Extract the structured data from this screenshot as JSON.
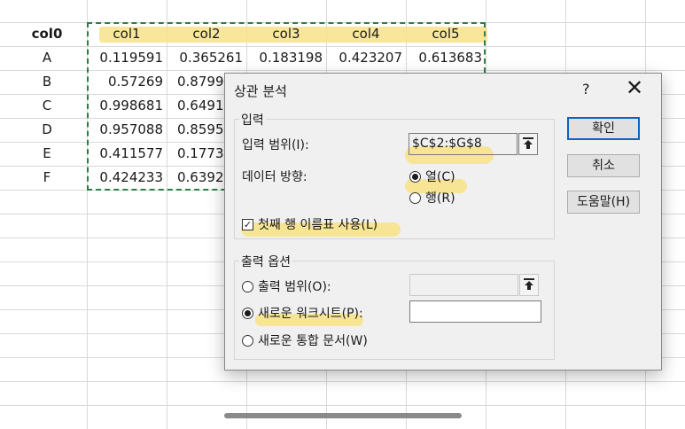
{
  "sheet": {
    "header": [
      "col0",
      "col1",
      "col2",
      "col3",
      "col4",
      "col5"
    ],
    "rows": [
      [
        "A",
        "0.119591",
        "0.365261",
        "0.183198",
        "0.423207",
        "0.613683"
      ],
      [
        "B",
        "0.57269",
        "0.8799"
      ],
      [
        "C",
        "0.998681",
        "0.6491"
      ],
      [
        "D",
        "0.957088",
        "0.8595"
      ],
      [
        "E",
        "0.411577",
        "0.1773"
      ],
      [
        "F",
        "0.424233",
        "0.6392"
      ]
    ]
  },
  "dialog": {
    "title": "상관 분석",
    "help": "?",
    "close": "✕",
    "input_group": {
      "label": "입력",
      "range_label": "입력 범위(I):",
      "range_value": "$C$2:$G$8",
      "direction_label": "데이터 방향:",
      "option_column": "열(C)",
      "option_row": "행(R)",
      "first_row_labels": "첫째 행 이름표 사용(L)"
    },
    "output_group": {
      "label": "출력 옵션",
      "output_range": "출력 범위(O):",
      "new_worksheet": "새로운 워크시트(P):",
      "new_workbook": "새로운 통합 문서(W)"
    },
    "buttons": {
      "ok": "확인",
      "cancel": "취소",
      "help": "도움말(H)"
    }
  },
  "colors": {
    "highlight": "#f7e28a",
    "marquee": "#2e7d46",
    "default_button": "#0a64c8"
  }
}
